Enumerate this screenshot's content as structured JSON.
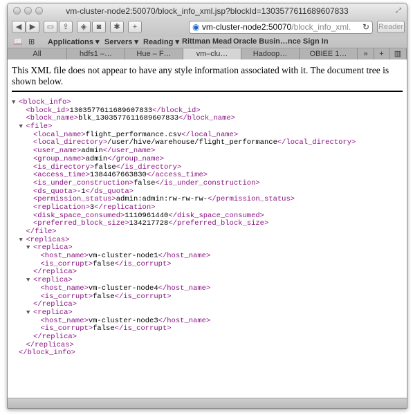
{
  "window": {
    "title": "vm-cluster-node2:50070/block_info_xml.jsp?blockId=1303577611689607833"
  },
  "toolbar": {
    "url_host": "vm-cluster-node2:50070",
    "url_path": "/block_info_xml.",
    "reader_label": "Reader"
  },
  "bookmarks": [
    "Applications ▾",
    "Servers ▾",
    "Reading ▾",
    "Rittman Mead",
    "Oracle Busin…nce Sign In"
  ],
  "tabs": [
    "All",
    "hdfs1 –…",
    "Hue – F…",
    "vm–clu…",
    "Hadoop…",
    "OBIEE 1…"
  ],
  "notice": "This XML file does not appear to have any style information associated with it. The document tree is shown below.",
  "xml_lines": [
    {
      "indent": 0,
      "toggle": true,
      "tag": "<block_info>",
      "text": "",
      "close": ""
    },
    {
      "indent": 1,
      "toggle": false,
      "tag": "<block_id>",
      "text": "1303577611689607833",
      "close": "</block_id>"
    },
    {
      "indent": 1,
      "toggle": false,
      "tag": "<block_name>",
      "text": "blk_1303577611689607833",
      "close": "</block_name>"
    },
    {
      "indent": 1,
      "toggle": true,
      "tag": "<file>",
      "text": "",
      "close": ""
    },
    {
      "indent": 2,
      "toggle": false,
      "tag": "<local_name>",
      "text": "flight_performance.csv",
      "close": "</local_name>"
    },
    {
      "indent": 2,
      "toggle": false,
      "tag": "<local_directory>",
      "text": "/user/hive/warehouse/flight_performance",
      "close": "</local_directory>"
    },
    {
      "indent": 2,
      "toggle": false,
      "tag": "<user_name>",
      "text": "admin",
      "close": "</user_name>"
    },
    {
      "indent": 2,
      "toggle": false,
      "tag": "<group_name>",
      "text": "admin",
      "close": "</group_name>"
    },
    {
      "indent": 2,
      "toggle": false,
      "tag": "<is_directory>",
      "text": "false",
      "close": "</is_directory>"
    },
    {
      "indent": 2,
      "toggle": false,
      "tag": "<access_time>",
      "text": "1384467663830",
      "close": "</access_time>"
    },
    {
      "indent": 2,
      "toggle": false,
      "tag": "<is_under_construction>",
      "text": "false",
      "close": "</is_under_construction>"
    },
    {
      "indent": 2,
      "toggle": false,
      "tag": "<ds_quota>",
      "text": "-1",
      "close": "</ds_quota>"
    },
    {
      "indent": 2,
      "toggle": false,
      "tag": "<permission_status>",
      "text": "admin:admin:rw-rw-rw-",
      "close": "</permission_status>"
    },
    {
      "indent": 2,
      "toggle": false,
      "tag": "<replication>",
      "text": "3",
      "close": "</replication>"
    },
    {
      "indent": 2,
      "toggle": false,
      "tag": "<disk_space_consumed>",
      "text": "1110961440",
      "close": "</disk_space_consumed>"
    },
    {
      "indent": 2,
      "toggle": false,
      "tag": "<preferred_block_size>",
      "text": "134217728",
      "close": "</preferred_block_size>"
    },
    {
      "indent": 1,
      "toggle": false,
      "tag": "</file>",
      "text": "",
      "close": ""
    },
    {
      "indent": 1,
      "toggle": true,
      "tag": "<replicas>",
      "text": "",
      "close": ""
    },
    {
      "indent": 2,
      "toggle": true,
      "tag": "<replica>",
      "text": "",
      "close": ""
    },
    {
      "indent": 3,
      "toggle": false,
      "tag": "<host_name>",
      "text": "vm-cluster-node1",
      "close": "</host_name>"
    },
    {
      "indent": 3,
      "toggle": false,
      "tag": "<is_corrupt>",
      "text": "false",
      "close": "</is_corrupt>"
    },
    {
      "indent": 2,
      "toggle": false,
      "tag": "</replica>",
      "text": "",
      "close": ""
    },
    {
      "indent": 2,
      "toggle": true,
      "tag": "<replica>",
      "text": "",
      "close": ""
    },
    {
      "indent": 3,
      "toggle": false,
      "tag": "<host_name>",
      "text": "vm-cluster-node4",
      "close": "</host_name>"
    },
    {
      "indent": 3,
      "toggle": false,
      "tag": "<is_corrupt>",
      "text": "false",
      "close": "</is_corrupt>"
    },
    {
      "indent": 2,
      "toggle": false,
      "tag": "</replica>",
      "text": "",
      "close": ""
    },
    {
      "indent": 2,
      "toggle": true,
      "tag": "<replica>",
      "text": "",
      "close": ""
    },
    {
      "indent": 3,
      "toggle": false,
      "tag": "<host_name>",
      "text": "vm-cluster-node3",
      "close": "</host_name>"
    },
    {
      "indent": 3,
      "toggle": false,
      "tag": "<is_corrupt>",
      "text": "false",
      "close": "</is_corrupt>"
    },
    {
      "indent": 2,
      "toggle": false,
      "tag": "</replica>",
      "text": "",
      "close": ""
    },
    {
      "indent": 1,
      "toggle": false,
      "tag": "</replicas>",
      "text": "",
      "close": ""
    },
    {
      "indent": 0,
      "toggle": false,
      "tag": "</block_info>",
      "text": "",
      "close": ""
    }
  ],
  "colors": {
    "xml_tag": "#881280",
    "xml_text": "#000000"
  },
  "icons": {
    "back": "back-icon",
    "forward": "forward-icon",
    "share": "share-icon",
    "reload": "reload-icon",
    "sidebar": "book-icon",
    "topsites": "grid-icon"
  }
}
